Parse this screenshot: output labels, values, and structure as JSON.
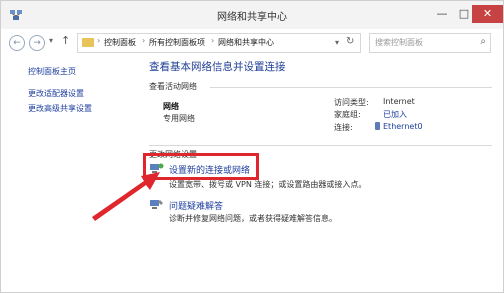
{
  "window": {
    "title": "网络和共享中心",
    "min_glyph": "—",
    "max_glyph": "□",
    "close_glyph": "✕"
  },
  "addressbar": {
    "crumbs": [
      "控制面板",
      "所有控制面板项",
      "网络和共享中心"
    ],
    "search_placeholder": "搜索控制面板"
  },
  "leftpane": {
    "links": [
      "控制面板主页",
      "更改适配器设置",
      "更改高级共享设置"
    ]
  },
  "main": {
    "title": "查看基本网络信息并设置连接",
    "active_networks_heading": "查看活动网络",
    "network": {
      "name": "网络",
      "type": "专用网络",
      "access_type_label": "访问类型:",
      "access_type_value": "Internet",
      "homegroup_label": "家庭组:",
      "homegroup_value": "已加入",
      "connection_label": "连接:",
      "connection_value": "Ethernet0"
    },
    "change_settings_heading": "更改网络设置",
    "tasks": [
      {
        "icon": "new-connection-icon",
        "label": "设置新的连接或网络",
        "desc": "设置宽带、拨号或 VPN 连接；或设置路由器或接入点。"
      },
      {
        "icon": "troubleshoot-icon",
        "label": "问题疑难解答",
        "desc": "诊断并修复网络问题，或者获得疑难解答信息。"
      }
    ]
  },
  "colors": {
    "annotation": "#e0262d",
    "link": "#1f3f9f"
  }
}
